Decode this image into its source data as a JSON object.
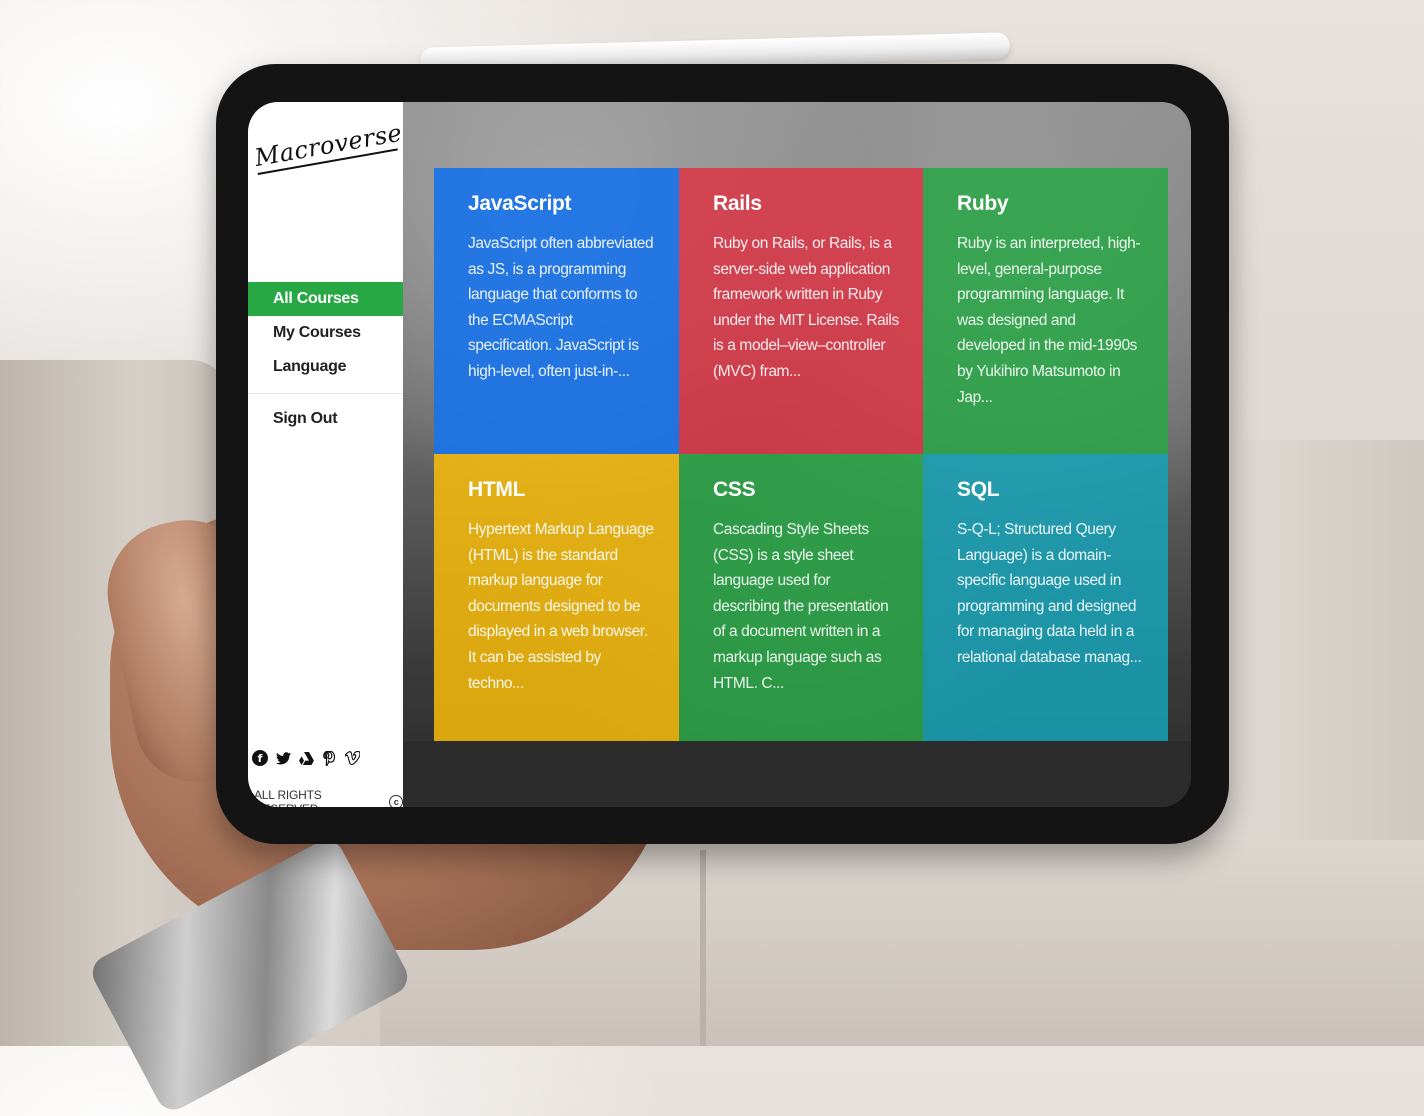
{
  "app": {
    "logo": "Macroverse"
  },
  "nav": {
    "items": [
      {
        "label": "All Courses",
        "active": true
      },
      {
        "label": "My Courses",
        "active": false
      },
      {
        "label": "Language",
        "active": false
      }
    ],
    "sign_out": "Sign Out"
  },
  "footer": {
    "socials": [
      "facebook-icon",
      "twitter-icon",
      "google-drive-icon",
      "pinterest-icon",
      "vimeo-icon"
    ],
    "rights": "ALL RIGHTS RESERVED",
    "copyright_icon": "copyright-icon"
  },
  "courses": [
    {
      "title": "JavaScript",
      "description": "JavaScript often abbreviated as JS, is a programming language that conforms to the ECMAScript specification. JavaScript is high-level, often just-in-...",
      "color": "#1a73e8"
    },
    {
      "title": "Rails",
      "description": "Ruby on Rails, or Rails, is a server-side web application framework written in Ruby under the MIT License. Rails is a model–view–controller (MVC) fram...",
      "color": "#dc3545"
    },
    {
      "title": "Ruby",
      "description": "Ruby is an interpreted, high-level, general-purpose programming language. It was designed and developed in the mid-1990s by Yukihiro Matsumoto in Jap...",
      "color": "#28a745"
    },
    {
      "title": "HTML",
      "description": "Hypertext Markup Language (HTML) is the standard markup language for documents designed to be displayed in a web browser. It can be assisted by techno...",
      "color": "#ffc107"
    },
    {
      "title": "CSS",
      "description": "Cascading Style Sheets (CSS) is a style sheet language used for describing the presentation of a document written in a markup language such as HTML. C...",
      "color": "#28a745"
    },
    {
      "title": "SQL",
      "description": "S-Q-L; Structured Query Language) is a domain-specific language used in programming and designed for managing data held in a relational database manag...",
      "color": "#17a2b8"
    }
  ]
}
